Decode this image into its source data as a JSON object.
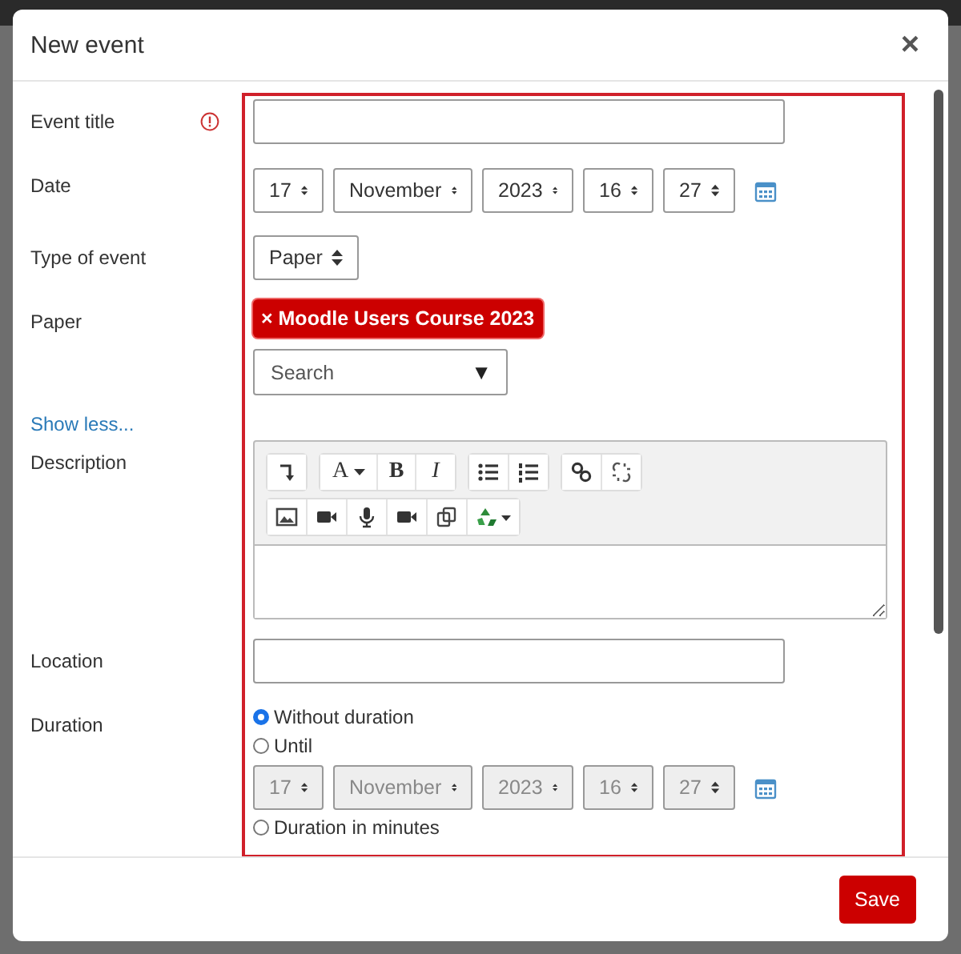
{
  "dialog": {
    "title": "New event",
    "close": "×"
  },
  "fields": [
    {
      "kind": "text",
      "label": "Event title",
      "required": true
    },
    {
      "kind": "datetime",
      "label": "Date",
      "disabled": false,
      "selects": [
        "17",
        "November",
        "2023",
        "16",
        "27"
      ]
    },
    {
      "kind": "select",
      "label": "Type of event",
      "value": "Paper"
    },
    {
      "kind": "autocomplete",
      "label": "Paper",
      "tags": [
        "× Moodle Users Course 2023"
      ],
      "placeholder": "Search",
      "toggle": "▼"
    },
    {
      "kind": "link",
      "label": "Show less..."
    },
    {
      "kind": "editor",
      "label": "Description",
      "toolbar": [
        [
          [
            {
              "kind": "undo"
            }
          ],
          [
            {
              "kind": "font",
              "text": "A"
            },
            {
              "kind": "bold",
              "text": "B"
            },
            {
              "kind": "italic",
              "text": "I"
            }
          ],
          [
            {
              "kind": "bullets"
            },
            {
              "kind": "numbers"
            }
          ],
          [
            {
              "kind": "link"
            },
            {
              "kind": "unlink"
            }
          ]
        ],
        [
          [
            {
              "kind": "image"
            },
            {
              "kind": "video"
            },
            {
              "kind": "audio"
            },
            {
              "kind": "video"
            },
            {
              "kind": "copy"
            },
            {
              "kind": "recycle"
            }
          ]
        ]
      ]
    },
    {
      "kind": "text",
      "label": "Location",
      "required": false
    },
    {
      "kind": "duration",
      "label": "Duration",
      "options": [
        {
          "label": "Without duration",
          "selected": true
        },
        {
          "label": "Until",
          "selected": false
        }
      ],
      "until": {
        "disabled": true,
        "selects": [
          "17",
          "November",
          "2023",
          "16",
          "27"
        ]
      },
      "more_options": [
        {
          "label": "Duration in minutes",
          "selected": false
        }
      ]
    }
  ],
  "footer": {
    "save": "Save"
  }
}
